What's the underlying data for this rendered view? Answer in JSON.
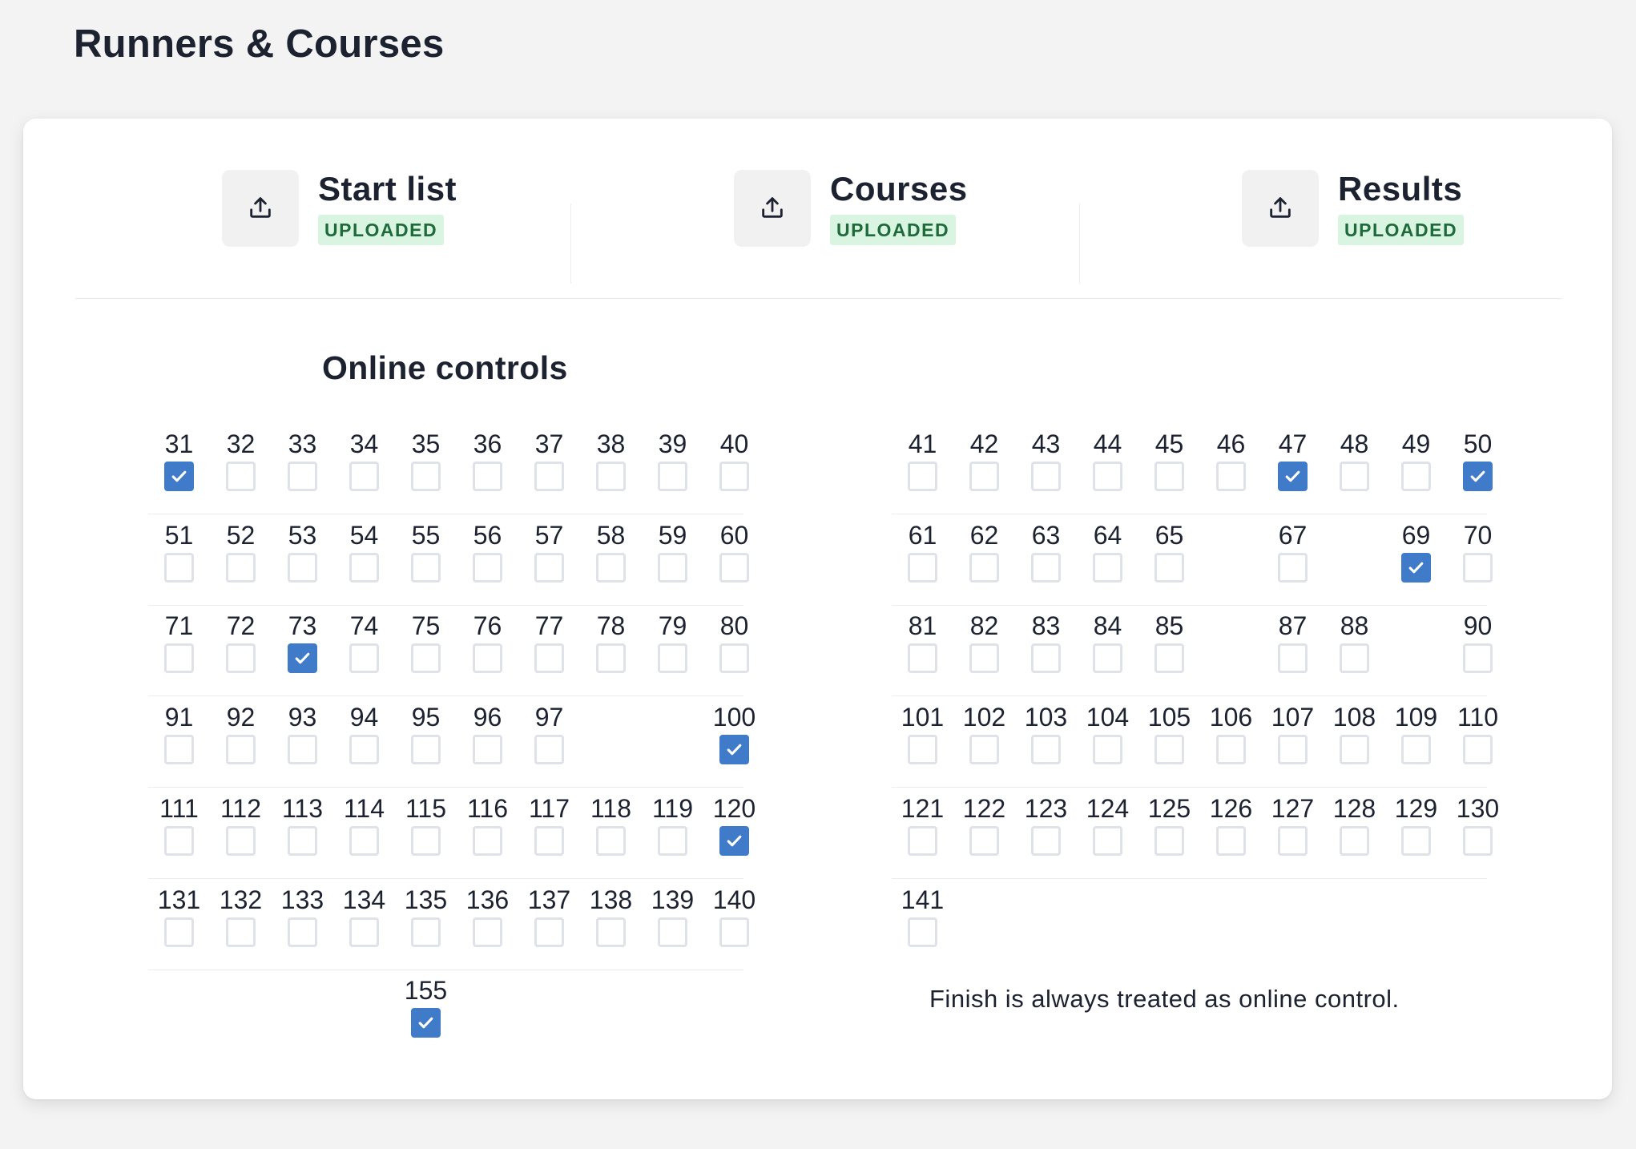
{
  "page": {
    "title": "Runners & Courses"
  },
  "uploads": [
    {
      "title": "Start list",
      "status": "UPLOADED",
      "icon": "upload-icon"
    },
    {
      "title": "Courses",
      "status": "UPLOADED",
      "icon": "upload-icon"
    },
    {
      "title": "Results",
      "status": "UPLOADED",
      "icon": "upload-icon"
    }
  ],
  "online_controls": {
    "title": "Online controls",
    "left_rows": [
      [
        {
          "n": "31",
          "checked": true
        },
        {
          "n": "32",
          "checked": false
        },
        {
          "n": "33",
          "checked": false
        },
        {
          "n": "34",
          "checked": false
        },
        {
          "n": "35",
          "checked": false
        },
        {
          "n": "36",
          "checked": false
        },
        {
          "n": "37",
          "checked": false
        },
        {
          "n": "38",
          "checked": false
        },
        {
          "n": "39",
          "checked": false
        },
        {
          "n": "40",
          "checked": false
        }
      ],
      [
        {
          "n": "51",
          "checked": false
        },
        {
          "n": "52",
          "checked": false
        },
        {
          "n": "53",
          "checked": false
        },
        {
          "n": "54",
          "checked": false
        },
        {
          "n": "55",
          "checked": false
        },
        {
          "n": "56",
          "checked": false
        },
        {
          "n": "57",
          "checked": false
        },
        {
          "n": "58",
          "checked": false
        },
        {
          "n": "59",
          "checked": false
        },
        {
          "n": "60",
          "checked": false
        }
      ],
      [
        {
          "n": "71",
          "checked": false
        },
        {
          "n": "72",
          "checked": false
        },
        {
          "n": "73",
          "checked": true
        },
        {
          "n": "74",
          "checked": false
        },
        {
          "n": "75",
          "checked": false
        },
        {
          "n": "76",
          "checked": false
        },
        {
          "n": "77",
          "checked": false
        },
        {
          "n": "78",
          "checked": false
        },
        {
          "n": "79",
          "checked": false
        },
        {
          "n": "80",
          "checked": false
        }
      ],
      [
        {
          "n": "91",
          "checked": false
        },
        {
          "n": "92",
          "checked": false
        },
        {
          "n": "93",
          "checked": false
        },
        {
          "n": "94",
          "checked": false
        },
        {
          "n": "95",
          "checked": false
        },
        {
          "n": "96",
          "checked": false
        },
        {
          "n": "97",
          "checked": false
        },
        null,
        null,
        {
          "n": "100",
          "checked": true
        }
      ],
      [
        {
          "n": "111",
          "checked": false
        },
        {
          "n": "112",
          "checked": false
        },
        {
          "n": "113",
          "checked": false
        },
        {
          "n": "114",
          "checked": false
        },
        {
          "n": "115",
          "checked": false
        },
        {
          "n": "116",
          "checked": false
        },
        {
          "n": "117",
          "checked": false
        },
        {
          "n": "118",
          "checked": false
        },
        {
          "n": "119",
          "checked": false
        },
        {
          "n": "120",
          "checked": true
        }
      ],
      [
        {
          "n": "131",
          "checked": false
        },
        {
          "n": "132",
          "checked": false
        },
        {
          "n": "133",
          "checked": false
        },
        {
          "n": "134",
          "checked": false
        },
        {
          "n": "135",
          "checked": false
        },
        {
          "n": "136",
          "checked": false
        },
        {
          "n": "137",
          "checked": false
        },
        {
          "n": "138",
          "checked": false
        },
        {
          "n": "139",
          "checked": false
        },
        {
          "n": "140",
          "checked": false
        }
      ],
      [
        null,
        null,
        null,
        null,
        {
          "n": "155",
          "checked": true
        },
        null,
        null,
        null,
        null,
        null
      ]
    ],
    "right_rows": [
      [
        {
          "n": "41",
          "checked": false
        },
        {
          "n": "42",
          "checked": false
        },
        {
          "n": "43",
          "checked": false
        },
        {
          "n": "44",
          "checked": false
        },
        {
          "n": "45",
          "checked": false
        },
        {
          "n": "46",
          "checked": false
        },
        {
          "n": "47",
          "checked": true
        },
        {
          "n": "48",
          "checked": false
        },
        {
          "n": "49",
          "checked": false
        },
        {
          "n": "50",
          "checked": true
        }
      ],
      [
        {
          "n": "61",
          "checked": false
        },
        {
          "n": "62",
          "checked": false
        },
        {
          "n": "63",
          "checked": false
        },
        {
          "n": "64",
          "checked": false
        },
        {
          "n": "65",
          "checked": false
        },
        null,
        {
          "n": "67",
          "checked": false
        },
        null,
        {
          "n": "69",
          "checked": true
        },
        {
          "n": "70",
          "checked": false
        }
      ],
      [
        {
          "n": "81",
          "checked": false
        },
        {
          "n": "82",
          "checked": false
        },
        {
          "n": "83",
          "checked": false
        },
        {
          "n": "84",
          "checked": false
        },
        {
          "n": "85",
          "checked": false
        },
        null,
        {
          "n": "87",
          "checked": false
        },
        {
          "n": "88",
          "checked": false
        },
        null,
        {
          "n": "90",
          "checked": false
        }
      ],
      [
        {
          "n": "101",
          "checked": false
        },
        {
          "n": "102",
          "checked": false
        },
        {
          "n": "103",
          "checked": false
        },
        {
          "n": "104",
          "checked": false
        },
        {
          "n": "105",
          "checked": false
        },
        {
          "n": "106",
          "checked": false
        },
        {
          "n": "107",
          "checked": false
        },
        {
          "n": "108",
          "checked": false
        },
        {
          "n": "109",
          "checked": false
        },
        {
          "n": "110",
          "checked": false
        }
      ],
      [
        {
          "n": "121",
          "checked": false
        },
        {
          "n": "122",
          "checked": false
        },
        {
          "n": "123",
          "checked": false
        },
        {
          "n": "124",
          "checked": false
        },
        {
          "n": "125",
          "checked": false
        },
        {
          "n": "126",
          "checked": false
        },
        {
          "n": "127",
          "checked": false
        },
        {
          "n": "128",
          "checked": false
        },
        {
          "n": "129",
          "checked": false
        },
        {
          "n": "130",
          "checked": false
        }
      ],
      [
        {
          "n": "141",
          "checked": false
        },
        null,
        null,
        null,
        null,
        null,
        null,
        null,
        null,
        null
      ]
    ],
    "finish_note": "Finish is always treated as online control."
  },
  "colors": {
    "accent": "#3f7bc9",
    "badge_bg": "#d9f5e1",
    "badge_text": "#1f6a3a"
  }
}
